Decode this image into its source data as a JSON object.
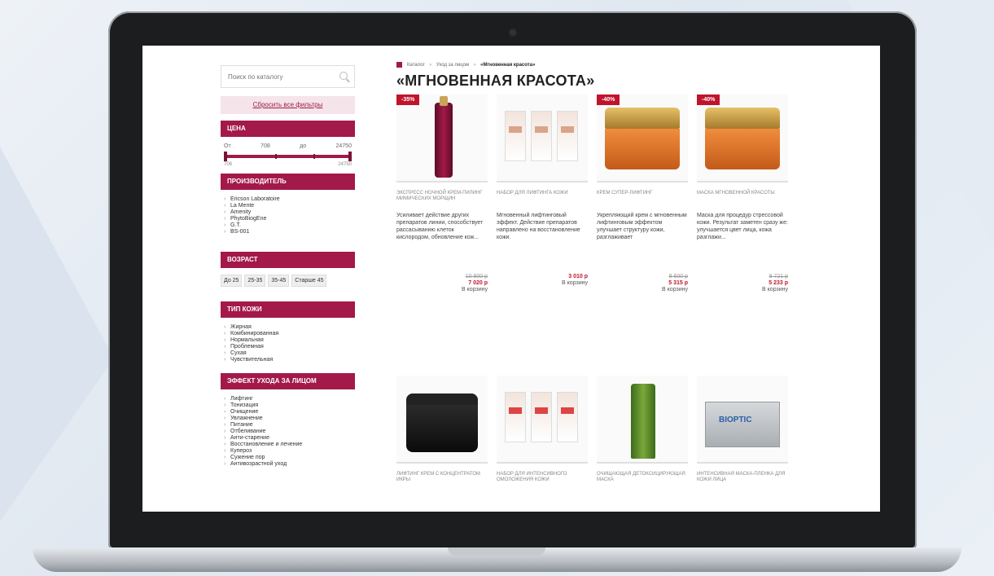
{
  "search": {
    "placeholder": "Поиск по каталогу"
  },
  "sidebar": {
    "reset_label": "Сбросить все фильтры",
    "price": {
      "title": "ЦЕНА",
      "from_label": "От",
      "from_value": "708",
      "to_label": "до",
      "to_value": "24750",
      "min": "708",
      "max": "24750"
    },
    "manufacturer": {
      "title": "ПРОИЗВОДИТЕЛЬ",
      "items": [
        "Ericson Laboratoire",
        "La Mente",
        "Amenity",
        "PhytoBiogEne",
        "G.T.",
        "BS-001"
      ]
    },
    "age": {
      "title": "ВОЗРАСТ",
      "options": [
        "До 25",
        "25-35",
        "35-45",
        "Старше 45"
      ]
    },
    "skin": {
      "title": "ТИП КОЖИ",
      "items": [
        "Жирная",
        "Комбинированная",
        "Нормальная",
        "Проблемная",
        "Сухая",
        "Чувствительная"
      ]
    },
    "effect": {
      "title": "ЭФФЕКТ УХОДА ЗА ЛИЦОМ",
      "items": [
        "Лифтинг",
        "Тонизация",
        "Очищение",
        "Увлажнение",
        "Питание",
        "Отбеливание",
        "Анти-старение",
        "Восстановление и лечение",
        "Купероз",
        "Сужение пор",
        "Антивозрастной уход"
      ]
    }
  },
  "main": {
    "breadcrumb": {
      "home": "Каталог",
      "level1": "Уход за лицом",
      "current": "«Мгновенная красота»"
    },
    "title": "«МГНОВЕННАЯ КРАСОТА»",
    "products": [
      {
        "badge": "-35%",
        "name": "ЭКСПРЕСС НОЧНОЙ КРЕМ-ПИЛИНГ МИМИЧЕСКИХ МОРЩИН",
        "desc": "Усиливает действие других препаратов линии, способствует рассасыванию клеток кислородом, обновление кож...",
        "old": "10 800 р",
        "new": "7 020 р",
        "cart": "В корзину"
      },
      {
        "badge": "",
        "name": "НАБОР ДЛЯ ЛИФТИНГА КОЖИ",
        "desc": "Мгновенный лифтинговый эффект. Действие препаратов направлено на восстановление кожи.",
        "old": "",
        "new": "3 010 р",
        "cart": "В корзину"
      },
      {
        "badge": "-40%",
        "name": "КРЕМ СУПЕР-ЛИФТИНГ",
        "desc": "Укрепляющий крем с мгновенным лифтинговым эффектом улучшает структуру кожи, разглаживает",
        "old": "8 600 р",
        "new": "5 315 р",
        "cart": "В корзину"
      },
      {
        "badge": "-40%",
        "name": "МАСКА МГНОВЕННОЙ КРАСОТЫ",
        "desc": "Маска для процедур стрессовой кожи. Результат заметен сразу же: улучшается цвет лица, кожа разглажи...",
        "old": "8 721 р",
        "new": "5 233 р",
        "cart": "В корзину"
      },
      {
        "badge": "",
        "name": "ЛИФТИНГ КРЕМ С КОНЦЕНТРАТОМ ИКРЫ",
        "desc": "",
        "old": "",
        "new": "",
        "cart": ""
      },
      {
        "badge": "",
        "name": "НАБОР ДЛЯ ИНТЕНСИВНОГО ОМОЛОЖЕНИЯ КОЖИ",
        "desc": "",
        "old": "",
        "new": "",
        "cart": ""
      },
      {
        "badge": "",
        "name": "ОЧИЩАЮЩАЯ ДЕТОКСИЦИРУЮЩАЯ МАСКА",
        "desc": "",
        "old": "",
        "new": "",
        "cart": ""
      },
      {
        "badge": "",
        "name": "ИНТЕНСИВНАЯ МАСКА-ПЛЕНКА ДЛЯ КОЖИ ЛИЦА",
        "desc": "",
        "old": "",
        "new": "",
        "cart": ""
      }
    ],
    "box_brand": "BIOPTIC"
  },
  "colors": {
    "accent": "#a3194a",
    "sale": "#c0142d"
  }
}
